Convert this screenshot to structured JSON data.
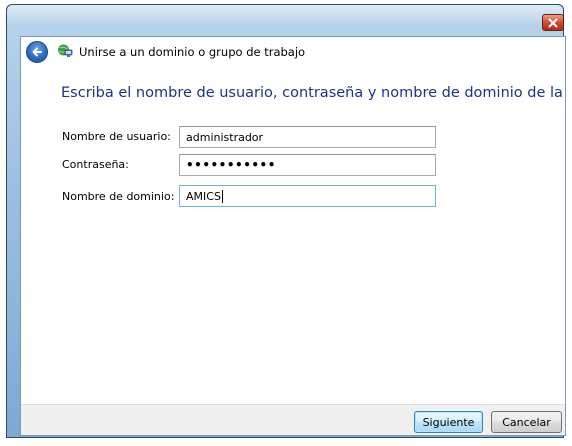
{
  "window": {
    "title": "Unirse a un dominio o grupo de trabajo",
    "instruction": "Escriba el nombre de usuario, contraseña y nombre de dominio de la cuenta"
  },
  "form": {
    "username": {
      "label": "Nombre de usuario:",
      "value": "administrador"
    },
    "password": {
      "label": "Contraseña:",
      "value": "•••••••••••"
    },
    "domain": {
      "label": "Nombre de dominio:",
      "value": "AMICS"
    }
  },
  "buttons": {
    "next": "Siguiente",
    "cancel": "Cancelar"
  },
  "icons": {
    "back": "back-arrow-icon",
    "wizard": "network-computer-icon",
    "close": "close-icon"
  },
  "colors": {
    "instruction_text": "#1e3287",
    "close_button": "#c8422b",
    "frame": "#9dc0e2"
  }
}
